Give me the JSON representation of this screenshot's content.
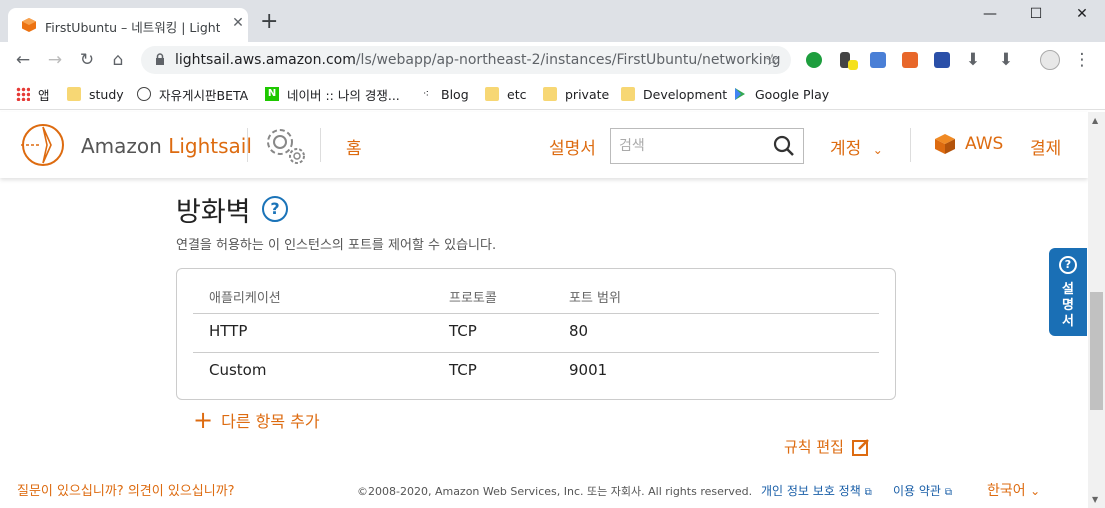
{
  "browser": {
    "tab_title": "FirstUbuntu – 네트워킹 | Lightsail",
    "url_domain": "lightsail.aws.amazon.com",
    "url_path": "/ls/webapp/ap-northeast-2/instances/FirstUbuntu/networking",
    "bookmarks": [
      "앱",
      "study",
      "자유게시판BETA",
      "네이버 :: 나의 경쟁...",
      "Blog",
      "etc",
      "private",
      "Development",
      "Google Play"
    ]
  },
  "header": {
    "brand_prefix": "Amazon ",
    "brand_name": "Lightsail",
    "home": "홈",
    "docs": "설명서",
    "search_placeholder": "검색",
    "account": "계정",
    "aws": "AWS",
    "billing": "결제"
  },
  "firewall": {
    "title": "방화벽",
    "help": "?",
    "description": "연결을 허용하는 이 인스턴스의 포트를 제어할 수 있습니다.",
    "columns": [
      "애플리케이션",
      "프로토콜",
      "포트 범위"
    ],
    "rows": [
      {
        "app": "HTTP",
        "protocol": "TCP",
        "port": "80"
      },
      {
        "app": "Custom",
        "protocol": "TCP",
        "port": "9001"
      }
    ],
    "add_label": "다른 항목 추가",
    "edit_label": "규칙 편집"
  },
  "footer": {
    "questions": "질문이 있으십니까? 의견이 있으십니까?",
    "copyright": "©2008-2020, Amazon Web Services, Inc. 또는 자회사. All rights reserved.",
    "privacy": "개인 정보 보호 정책",
    "terms": "이용 약관",
    "language": "한국어"
  },
  "help_tab": {
    "label": "설명서",
    "icon": "?"
  },
  "colors": {
    "accent": "#dd6b10",
    "link": "#1a5fa8",
    "help_blue": "#1a6fb5"
  }
}
